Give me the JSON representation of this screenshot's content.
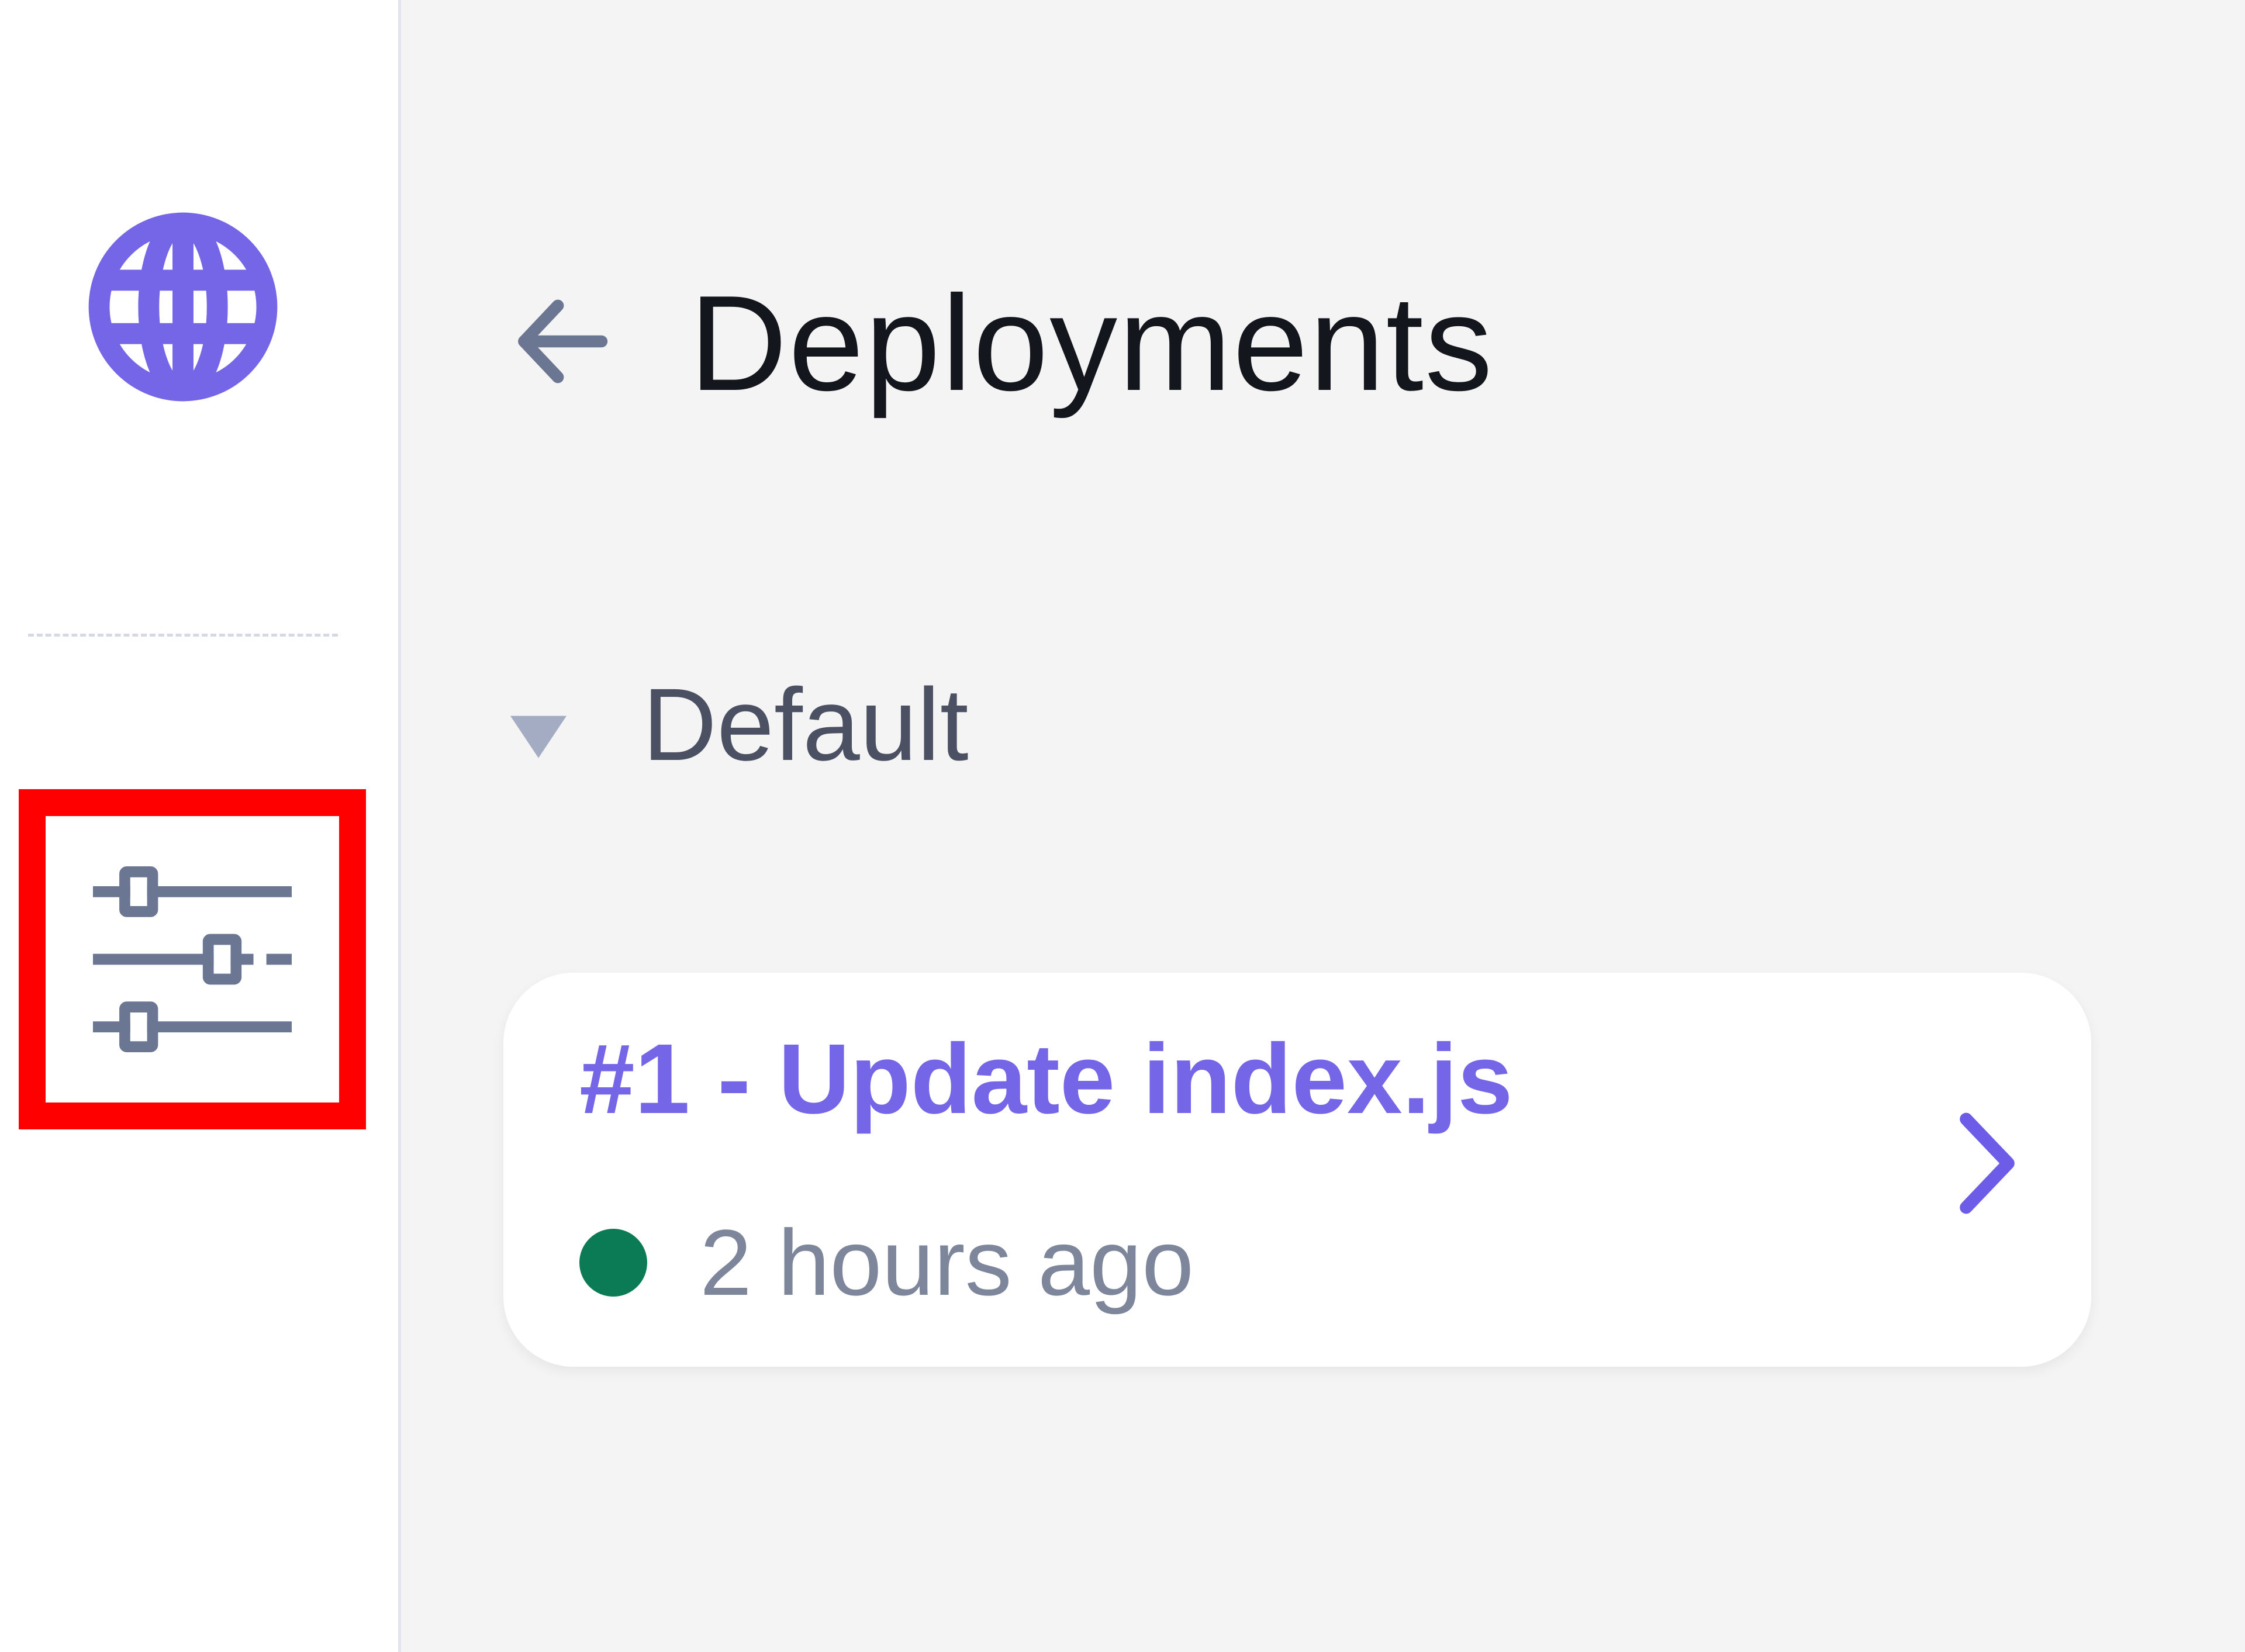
{
  "colors": {
    "accent": "#7566e8",
    "status_success": "#0a7b55",
    "highlight_box": "#ff0000",
    "icon_muted": "#6b7692"
  },
  "sidebar": {
    "items": [
      {
        "name": "globe",
        "icon": "globe-icon"
      },
      {
        "name": "settings",
        "icon": "sliders-icon",
        "highlighted": true
      }
    ]
  },
  "header": {
    "back_icon": "arrow-left-icon",
    "title": "Deployments"
  },
  "section": {
    "label": "Default",
    "expanded": true,
    "caret_icon": "caret-down-icon"
  },
  "deployments": [
    {
      "title": "#1 - Update index.js",
      "time": "2 hours ago",
      "status": "success",
      "chevron_icon": "chevron-right-icon"
    }
  ]
}
